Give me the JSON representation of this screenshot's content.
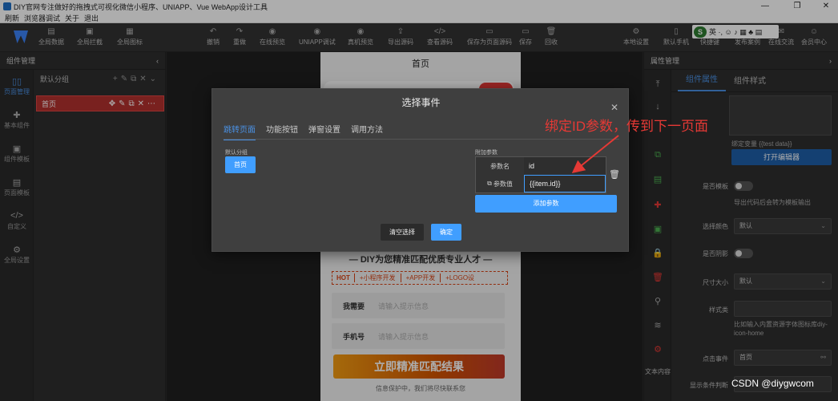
{
  "window": {
    "title": "DIY官网专注做好的拖拽式可视化微信小程序、UNIAPP、Vue WebApp设计工具",
    "minimize": "—",
    "maximize": "❐",
    "close": "✕"
  },
  "menubar": {
    "items": [
      "刷新",
      "浏览器调试",
      "关于",
      "退出"
    ]
  },
  "toolbar": {
    "left": [
      {
        "label": "全局数据",
        "icon": "database-icon"
      },
      {
        "label": "全局拦截",
        "icon": "intercept-icon"
      },
      {
        "label": "全局图标",
        "icon": "image-icon"
      }
    ],
    "center": [
      {
        "label": "撤销",
        "icon": "undo-icon"
      },
      {
        "label": "重做",
        "icon": "redo-icon"
      },
      {
        "label": "在线预览",
        "icon": "eye-icon"
      },
      {
        "label": "UNIAPP调试",
        "icon": "eye-icon"
      },
      {
        "label": "真机预览",
        "icon": "eye-icon"
      },
      {
        "label": "导出源码",
        "icon": "export-icon"
      },
      {
        "label": "查看源码",
        "icon": "code-icon"
      },
      {
        "label": "保存为页面源码",
        "icon": "save-icon"
      },
      {
        "label": "保存",
        "icon": "save-icon"
      },
      {
        "label": "回收",
        "icon": "trash-icon"
      }
    ],
    "right": [
      {
        "label": "本地设置",
        "icon": "settings-icon"
      },
      {
        "label": "默认手机",
        "icon": "phone-icon"
      },
      {
        "label": "快捷键",
        "icon": "keyboard-icon"
      },
      {
        "label": "发布案例",
        "icon": "upload-icon"
      },
      {
        "label": "在线交流",
        "icon": "chat-icon"
      },
      {
        "label": "会员中心",
        "icon": "user-icon"
      }
    ]
  },
  "ime_tray": {
    "letter": "S",
    "text": "英 ·, ☺ ♪ ▦ ♣ ▤"
  },
  "left_panel": {
    "title": "组件管理",
    "nav": [
      {
        "label": "页面管理",
        "icon": "pages-icon"
      },
      {
        "label": "基本组件",
        "icon": "puzzle-icon"
      },
      {
        "label": "组件模板",
        "icon": "template-icon"
      },
      {
        "label": "页面模板",
        "icon": "page-template-icon"
      },
      {
        "label": "自定义",
        "icon": "code-icon"
      },
      {
        "label": "全局设置",
        "icon": "gear-icon"
      }
    ],
    "group_label": "默认分组",
    "page_item": "首页"
  },
  "phone": {
    "title": "首页",
    "banner_text": "— DIY为您精准匹配优质专业人才 —",
    "tags": [
      "HOT",
      "+小程序开发",
      "+APP开发",
      "+LOGO设"
    ],
    "fields": [
      {
        "label": "我需要",
        "placeholder": "请输入提示信息"
      },
      {
        "label": "手机号",
        "placeholder": "请输入提示信息"
      }
    ],
    "cta": "立即精准匹配结果",
    "privacy": "信息保护中，我们将尽快联系您"
  },
  "modal": {
    "title": "选择事件",
    "tabs": [
      "跳转页面",
      "功能按钮",
      "弹窗设置",
      "调用方法"
    ],
    "default_group_title": "默认分组",
    "page_button": "首页",
    "extra_params_title": "附加参数",
    "param_name_label": "参数名",
    "param_name_value": "id",
    "param_value_label": "参数值",
    "param_value_value": "{{item.id}}",
    "add_param_button": "添加参数",
    "clear_button": "清空选择",
    "confirm_button": "确定"
  },
  "annotation": "绑定ID参数，传到下一页面",
  "right_panel": {
    "title": "属性管理",
    "tabs": [
      "组件属性",
      "组件样式"
    ],
    "bind_var": "绑定变量 {{test data}}",
    "open_editor": "打开编辑器",
    "rows": [
      {
        "label": "是否模板",
        "type": "toggle",
        "hint": "导出代码后会转为模板输出"
      },
      {
        "label": "选择颜色",
        "type": "select",
        "value": "默认"
      },
      {
        "label": "是否阴影",
        "type": "toggle"
      },
      {
        "label": "尺寸大小",
        "type": "select",
        "value": "默认"
      },
      {
        "label": "样式类",
        "type": "input",
        "hint": "比如输入内置资源字体图标库diy-icon-home"
      },
      {
        "label": "点击事件",
        "type": "select",
        "value": "首页"
      },
      {
        "label": "显示条件判断",
        "type": "input"
      }
    ],
    "text_content_label": "文本内容"
  },
  "watermark": "CSDN @diygwcom"
}
